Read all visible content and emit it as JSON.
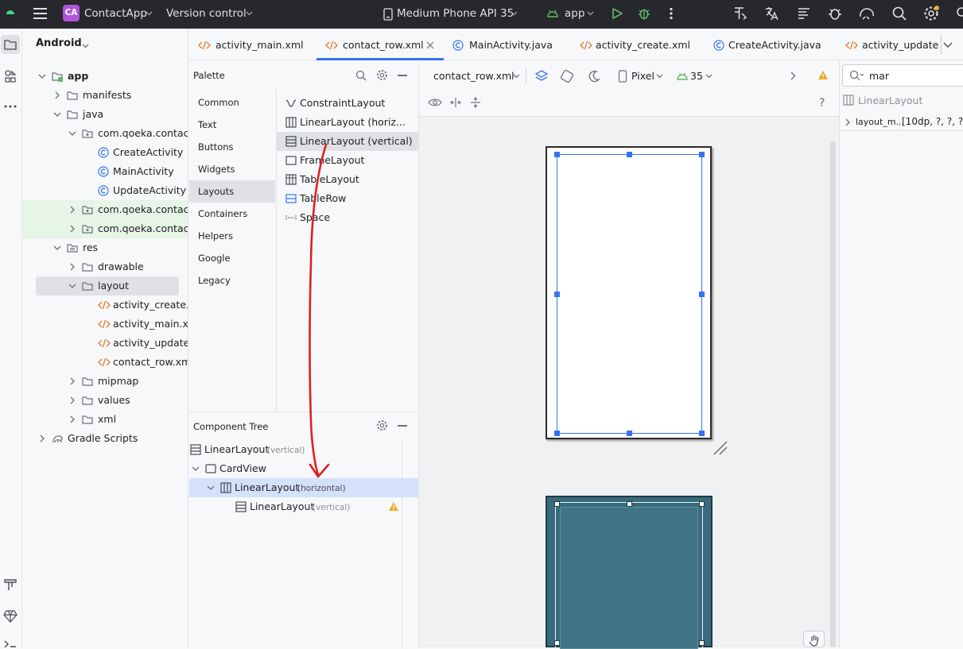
{
  "topbar": {
    "app_badge": "CA",
    "app_name": "ContactApp",
    "vcs": "Version control",
    "device": "Medium Phone API 35",
    "run_config": "app"
  },
  "project": {
    "view_mode": "Android",
    "tree": [
      {
        "label": "app",
        "bold": true
      },
      {
        "label": "manifests"
      },
      {
        "label": "java"
      },
      {
        "label": "com.qoeka.contacta"
      },
      {
        "label": "CreateActivity"
      },
      {
        "label": "MainActivity"
      },
      {
        "label": "UpdateActivity"
      },
      {
        "label": "com.qoeka.contacta"
      },
      {
        "label": "com.qoeka.contacta"
      },
      {
        "label": "res"
      },
      {
        "label": "drawable"
      },
      {
        "label": "layout"
      },
      {
        "label": "activity_create.xr"
      },
      {
        "label": "activity_main.xm"
      },
      {
        "label": "activity_update.x"
      },
      {
        "label": "contact_row.xml"
      },
      {
        "label": "mipmap"
      },
      {
        "label": "values"
      },
      {
        "label": "xml"
      },
      {
        "label": "Gradle Scripts"
      }
    ]
  },
  "tabs": [
    {
      "label": "activity_main.xml"
    },
    {
      "label": "contact_row.xml",
      "active": true
    },
    {
      "label": "MainActivity.java"
    },
    {
      "label": "activity_create.xml"
    },
    {
      "label": "CreateActivity.java"
    },
    {
      "label": "activity_update"
    }
  ],
  "palette": {
    "title": "Palette",
    "categories": [
      "Common",
      "Text",
      "Buttons",
      "Widgets",
      "Layouts",
      "Containers",
      "Helpers",
      "Google",
      "Legacy"
    ],
    "selected_category": "Layouts",
    "items": [
      "ConstraintLayout",
      "LinearLayout (horiz...",
      "LinearLayout (vertical)",
      "FrameLayout",
      "TableLayout",
      "TableRow",
      "Space"
    ]
  },
  "component_tree": {
    "title": "Component Tree",
    "rows": [
      {
        "label": "LinearLayout",
        "sub": "(vertical)"
      },
      {
        "label": "CardView",
        "sub": ""
      },
      {
        "label": "LinearLayout",
        "sub": "(horizontal)"
      },
      {
        "label": "LinearLayout",
        "sub": "(vertical)"
      }
    ]
  },
  "design_toolbar": {
    "file": "contact_row.xml",
    "device": "Pixel",
    "api": "35",
    "help": "?"
  },
  "attributes": {
    "search_value": "mar",
    "component": "LinearLayout",
    "attr_name": "layout_m...",
    "attr_value": "[10dp, ?, ?, ?"
  },
  "colors": {
    "accent": "#3574f0",
    "selection": "#d5e1fb",
    "blueprint": "#386b7c",
    "annotation": "#e02020",
    "xml_icon": "#e07a2f",
    "class_icon": "#3574f0",
    "warning": "#f0a92b"
  }
}
